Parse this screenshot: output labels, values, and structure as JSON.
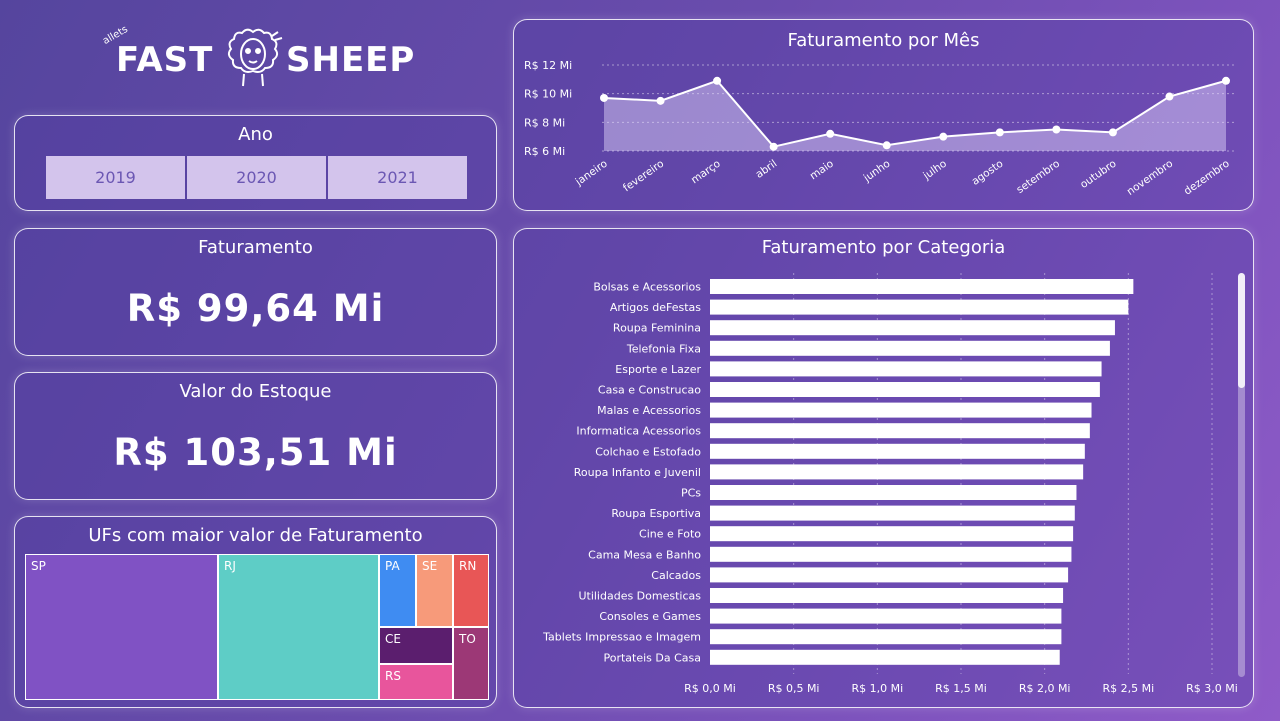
{
  "logo": {
    "word1": "FAST",
    "word2": "SHEEP",
    "tiny": "allets"
  },
  "ano": {
    "title": "Ano",
    "options": [
      "2019",
      "2020",
      "2021"
    ]
  },
  "faturamento": {
    "title": "Faturamento",
    "value": "R$ 99,64 Mi"
  },
  "estoque": {
    "title": "Valor do Estoque",
    "value": "R$ 103,51 Mi"
  },
  "ufs": {
    "title": "UFs com maior valor de Faturamento",
    "items": [
      {
        "label": "SP",
        "color": "#8052c4"
      },
      {
        "label": "RJ",
        "color": "#5ecdc6"
      },
      {
        "label": "PA",
        "color": "#3f8cf2"
      },
      {
        "label": "SE",
        "color": "#f79a7a"
      },
      {
        "label": "RN",
        "color": "#e85656"
      },
      {
        "label": "CE",
        "color": "#5b1e6e"
      },
      {
        "label": "TO",
        "color": "#9c3876"
      },
      {
        "label": "RS",
        "color": "#e8559c"
      }
    ]
  },
  "mes_chart_title": "Faturamento por Mês",
  "cat_chart_title": "Faturamento por Categoria",
  "chart_data": [
    {
      "type": "area",
      "title": "Faturamento por Mês",
      "categories": [
        "janeiro",
        "fevereiro",
        "março",
        "abril",
        "maio",
        "junho",
        "julho",
        "agosto",
        "setembro",
        "outubro",
        "novembro",
        "dezembro"
      ],
      "values": [
        9.7,
        9.5,
        10.9,
        6.3,
        7.2,
        6.4,
        7.0,
        7.3,
        7.5,
        7.3,
        9.8,
        10.9
      ],
      "yticks": [
        "R$ 6 Mi",
        "R$ 8 Mi",
        "R$ 10 Mi",
        "R$ 12 Mi"
      ],
      "ylim": [
        6,
        12
      ],
      "unit": "R$ Mi"
    },
    {
      "type": "bar",
      "orientation": "horizontal",
      "title": "Faturamento por Categoria",
      "categories": [
        "Bolsas e Acessorios",
        "Artigos deFestas",
        "Roupa Feminina",
        "Telefonia Fixa",
        "Esporte e Lazer",
        "Casa e Construcao",
        "Malas e Acessorios",
        "Informatica Acessorios",
        "Colchao e Estofado",
        "Roupa Infanto e Juvenil",
        "PCs",
        "Roupa Esportiva",
        "Cine e Foto",
        "Cama Mesa e Banho",
        "Calcados",
        "Utilidades Domesticas",
        "Consoles e Games",
        "Tablets Impressao e Imagem",
        "Portateis Da Casa"
      ],
      "values": [
        2.53,
        2.5,
        2.42,
        2.39,
        2.34,
        2.33,
        2.28,
        2.27,
        2.24,
        2.23,
        2.19,
        2.18,
        2.17,
        2.16,
        2.14,
        2.11,
        2.1,
        2.1,
        2.09
      ],
      "xticks": [
        "R$ 0,0 Mi",
        "R$ 0,5 Mi",
        "R$ 1,0 Mi",
        "R$ 1,5 Mi",
        "R$ 2,0 Mi",
        "R$ 2,5 Mi",
        "R$ 3,0 Mi"
      ],
      "xlim": [
        0,
        3.0
      ],
      "unit": "R$ Mi"
    }
  ]
}
